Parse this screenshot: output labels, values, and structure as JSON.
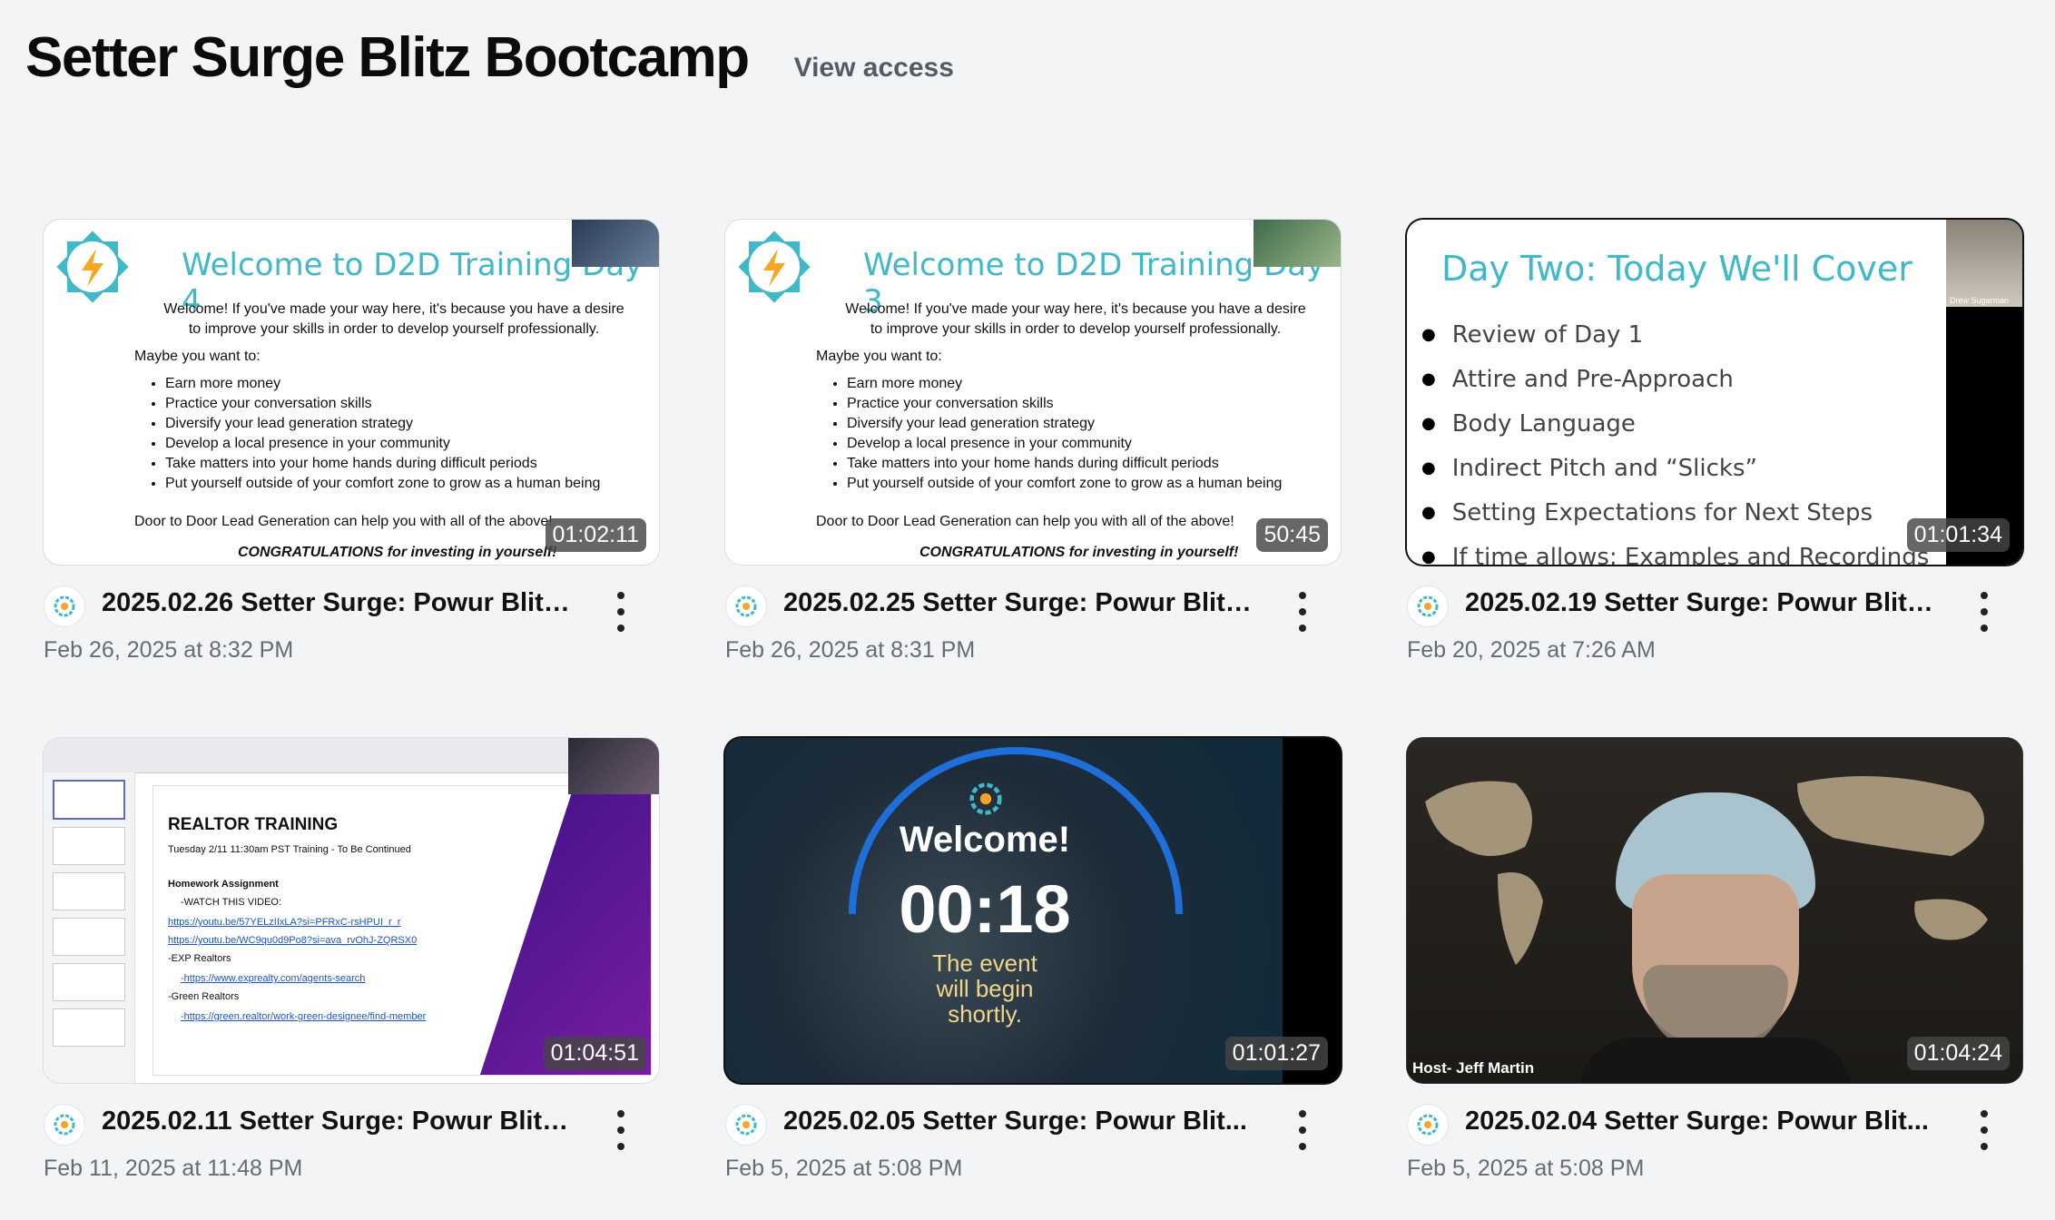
{
  "page": {
    "title": "Setter Surge Blitz Bootcamp",
    "view_access": "View access"
  },
  "videos": [
    {
      "title": "2025.02.26 Setter Surge: Powur Blitz...",
      "date": "Feb 26, 2025 at 8:32 PM",
      "duration": "01:02:11",
      "slide": {
        "heading": "Welcome to D2D Training Day 4",
        "intro": "Welcome! If you've made your way here, it's because you have a desire to improve your skills in order to develop yourself professionally.",
        "maybe": "Maybe you want to:",
        "bullets": [
          "Earn more money",
          "Practice your conversation skills",
          "Diversify your lead generation strategy",
          "Develop a local presence in your community",
          "Take matters into your home hands during difficult periods",
          "Put yourself outside of your comfort zone to grow as a human being"
        ],
        "footer": "Door to Door Lead Generation can help you with all of the above!",
        "congrats": "CONGRATULATIONS for investing in yourself!"
      }
    },
    {
      "title": "2025.02.25 Setter Surge: Powur Blitz...",
      "date": "Feb 26, 2025 at 8:31 PM",
      "duration": "50:45",
      "slide": {
        "heading": "Welcome to D2D Training Day 3",
        "intro": "Welcome! If you've made your way here, it's because you have a desire to improve your skills in order to develop yourself professionally.",
        "maybe": "Maybe you want to:",
        "bullets": [
          "Earn more money",
          "Practice your conversation skills",
          "Diversify your lead generation strategy",
          "Develop a local presence in your community",
          "Take matters into your home hands during difficult periods",
          "Put yourself outside of your comfort zone to grow as a human being"
        ],
        "footer": "Door to Door Lead Generation can help you with all of the above!",
        "congrats": "CONGRATULATIONS for investing in yourself!"
      }
    },
    {
      "title": "2025.02.19 Setter Surge: Powur Blitz ...",
      "date": "Feb 20, 2025 at 7:26 AM",
      "duration": "01:01:34",
      "slide": {
        "heading": "Day Two: Today We'll Cover",
        "bullets": [
          "Review of Day 1",
          "Attire and Pre-Approach",
          "Body Language",
          "Indirect Pitch and “Slicks”",
          "Setting Expectations for Next Steps",
          "If time allows: Examples and Recordings"
        ],
        "cam_name": "Drew Sugarman"
      }
    },
    {
      "title": "2025.02.11 Setter Surge: Powur Blitz ...",
      "date": "Feb 11, 2025 at 11:48 PM",
      "duration": "01:04:51",
      "slide": {
        "heading": "REALTOR TRAINING",
        "subheading": "Tuesday 2/11 11:30am PST Training - To Be Continued",
        "hw": "Homework Assignment",
        "watch": "-WATCH THIS VIDEO:",
        "link1": "https://youtu.be/57YELzIIxLA?si=PFRxC-rsHPUI_r_r",
        "link2": "https://youtu.be/WC9qu0d9Po8?si=ava_rvOhJ-ZQRSX0",
        "exp": "-EXP Realtors",
        "link3": "-https://www.exprealty.com/agents-search",
        "green": "-Green Realtors",
        "link4": "-https://green.realtor/work-green-designee/find-member"
      }
    },
    {
      "title": "2025.02.05 Setter Surge: Powur Blit...",
      "date": "Feb 5, 2025 at 5:08 PM",
      "duration": "01:01:27",
      "slide": {
        "welcome": "Welcome!",
        "countdown": "00:18",
        "sub1": "The event",
        "sub2": "will begin",
        "sub3": "shortly."
      }
    },
    {
      "title": "2025.02.04 Setter Surge: Powur Blit...",
      "date": "Feb 5, 2025 at 5:08 PM",
      "duration": "01:04:24",
      "slide": {
        "host": "Host- Jeff Martin"
      }
    }
  ],
  "colors": {
    "accent": "#3fb8c8",
    "logo_orange": "#f5a623",
    "background": "#f3f4f6"
  }
}
